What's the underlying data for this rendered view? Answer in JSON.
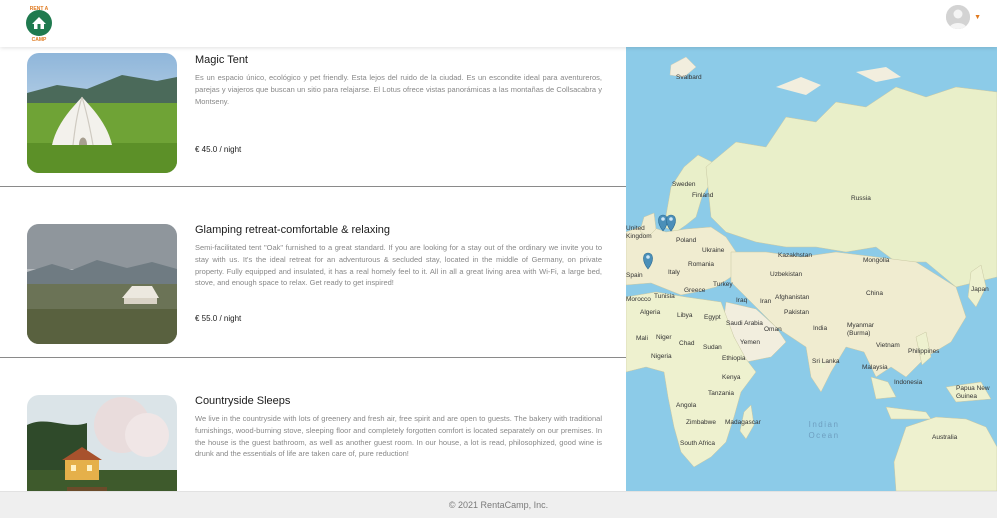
{
  "header": {
    "logo_text_top": "RENT A",
    "logo_text_bottom": "CAMP",
    "brand_color": "#1f7a4f",
    "accent_color": "#e07a1f"
  },
  "listings": [
    {
      "title": "Magic Tent",
      "description": "Es un espacio único, ecológico y pet friendly. Esta lejos del ruido de la ciudad. Es un escondite ideal para aventureros, parejas y viajeros que buscan un sitio para relajarse. El Lotus ofrece vistas panorámicas a las montañas de Collsacabra y Montseny.",
      "price": "€ 45.0 / night"
    },
    {
      "title": "Glamping retreat-comfortable & relaxing",
      "description": "Semi-facilitated tent \"Oak\" furnished to a great standard. If you are looking for a stay out of the ordinary we invite you to stay with us. It's the ideal retreat for an adventurous & secluded stay, located in the middle of Germany, on private property. Fully equipped and insulated, it has a real homely feel to it. All in all a great living area with Wi-Fi, a large bed, stove, and enough space to relax. Get ready to get inspired!",
      "price": "€ 55.0 / night"
    },
    {
      "title": "Countryside Sleeps",
      "description": "We live in the countryside with lots of greenery and fresh air, free spirit and are open to guests. The bakery with traditional furnishings, wood-burning stove, sleeping floor and completely forgotten comfort is located separately on our premises. In the house is the guest bathroom, as well as another guest room. In our house, a lot is read, philosophized, good wine is drunk and the essentials of life are taken care of, pure reduction!",
      "price": ""
    }
  ],
  "map": {
    "labels": [
      {
        "text": "Svalbard"
      },
      {
        "text": "Sweden"
      },
      {
        "text": "Finland"
      },
      {
        "text": "Russia"
      },
      {
        "text": "United Kingdom"
      },
      {
        "text": "Poland"
      },
      {
        "text": "Ukraine"
      },
      {
        "text": "Kazakhstan"
      },
      {
        "text": "Mongolia"
      },
      {
        "text": "Spain"
      },
      {
        "text": "Italy"
      },
      {
        "text": "Romania"
      },
      {
        "text": "Uzbekistan"
      },
      {
        "text": "Turkey"
      },
      {
        "text": "Greece"
      },
      {
        "text": "Tunisia"
      },
      {
        "text": "Iraq"
      },
      {
        "text": "Iran"
      },
      {
        "text": "Afghanistan"
      },
      {
        "text": "China"
      },
      {
        "text": "Algeria"
      },
      {
        "text": "Libya"
      },
      {
        "text": "Egypt"
      },
      {
        "text": "Saudi Arabia"
      },
      {
        "text": "Oman"
      },
      {
        "text": "Pakistan"
      },
      {
        "text": "India"
      },
      {
        "text": "Myanmar (Burma)"
      },
      {
        "text": "Mali"
      },
      {
        "text": "Niger"
      },
      {
        "text": "Chad"
      },
      {
        "text": "Sudan"
      },
      {
        "text": "Yemen"
      },
      {
        "text": "Nigeria"
      },
      {
        "text": "Ethiopia"
      },
      {
        "text": "Vietnam"
      },
      {
        "text": "Philippines"
      },
      {
        "text": "Sri Lanka"
      },
      {
        "text": "Kenya"
      },
      {
        "text": "Malaysia"
      },
      {
        "text": "Tanzania"
      },
      {
        "text": "Indonesia"
      },
      {
        "text": "Papua New Guinea"
      },
      {
        "text": "Angola"
      },
      {
        "text": "Zimbabwe"
      },
      {
        "text": "Madagascar"
      },
      {
        "text": "South Africa"
      },
      {
        "text": "Australia"
      },
      {
        "text": "Indian Ocean"
      },
      {
        "text": "Japan"
      },
      {
        "text": "Morocco"
      }
    ]
  },
  "footer": {
    "copyright": "© 2021 RentaCamp, Inc."
  }
}
